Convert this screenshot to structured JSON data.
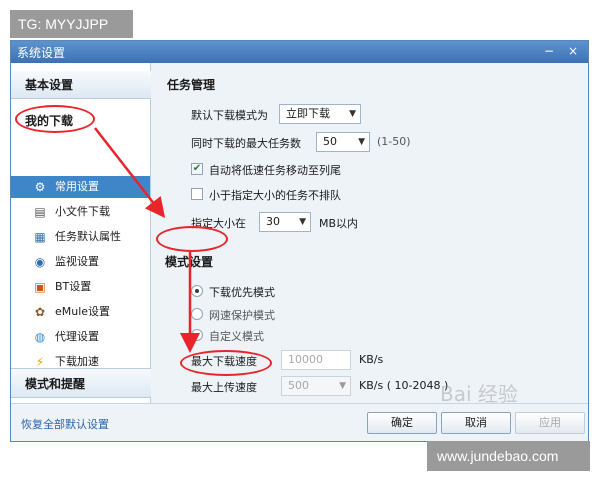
{
  "badges": {
    "top_left": "TG: MYYJJPP",
    "bottom_right": "www.jundebao.com",
    "watermark": "Bai 经验"
  },
  "window": {
    "title": "系统设置",
    "minimize": "−",
    "close": "×"
  },
  "sidebar": {
    "basic": "基本设置",
    "my_downloads": "我的下载",
    "items": [
      {
        "label": "常用设置",
        "icon": "gear-icon",
        "glyph": "⚙"
      },
      {
        "label": "小文件下载",
        "icon": "file-icon",
        "glyph": "▤"
      },
      {
        "label": "任务默认属性",
        "icon": "task-icon",
        "glyph": "▦"
      },
      {
        "label": "监视设置",
        "icon": "monitor-icon",
        "glyph": "◉"
      },
      {
        "label": "BT设置",
        "icon": "bt-icon",
        "glyph": "▣"
      },
      {
        "label": "eMule设置",
        "icon": "emule-icon",
        "glyph": "✿"
      },
      {
        "label": "代理设置",
        "icon": "proxy-icon",
        "glyph": "◍"
      },
      {
        "label": "下载加速",
        "icon": "lightning-icon",
        "glyph": "⚡"
      }
    ],
    "mode": "模式和提醒"
  },
  "task": {
    "title": "任务管理",
    "default_mode_label": "默认下载模式为",
    "default_mode_value": "立即下载",
    "max_tasks_label": "同时下载的最大任务数",
    "max_tasks_value": "50",
    "max_tasks_hint": "(1-50)",
    "auto_move_label": "自动将低速任务移动至列尾",
    "auto_move_checked": true,
    "skip_small_label": "小于指定大小的任务不排队",
    "skip_small_checked": false,
    "size_label": "指定大小在",
    "size_value": "30",
    "size_unit": "MB以内"
  },
  "mode": {
    "title": "模式设置",
    "options": [
      "下载优先模式",
      "网速保护模式",
      "自定义模式"
    ],
    "selected": 0,
    "max_down_label": "最大下载速度",
    "max_down_value": "10000",
    "max_down_unit": "KB/s",
    "max_up_label": "最大上传速度",
    "max_up_value": "500",
    "max_up_unit": "KB/s  ( 10-2048 )"
  },
  "footer": {
    "restore": "恢复全部默认设置",
    "ok": "确定",
    "cancel": "取消",
    "apply": "应用"
  },
  "colors": {
    "accent": "#3f86c9",
    "annotation": "#e8252b",
    "titlebar": "#4a82c2"
  }
}
